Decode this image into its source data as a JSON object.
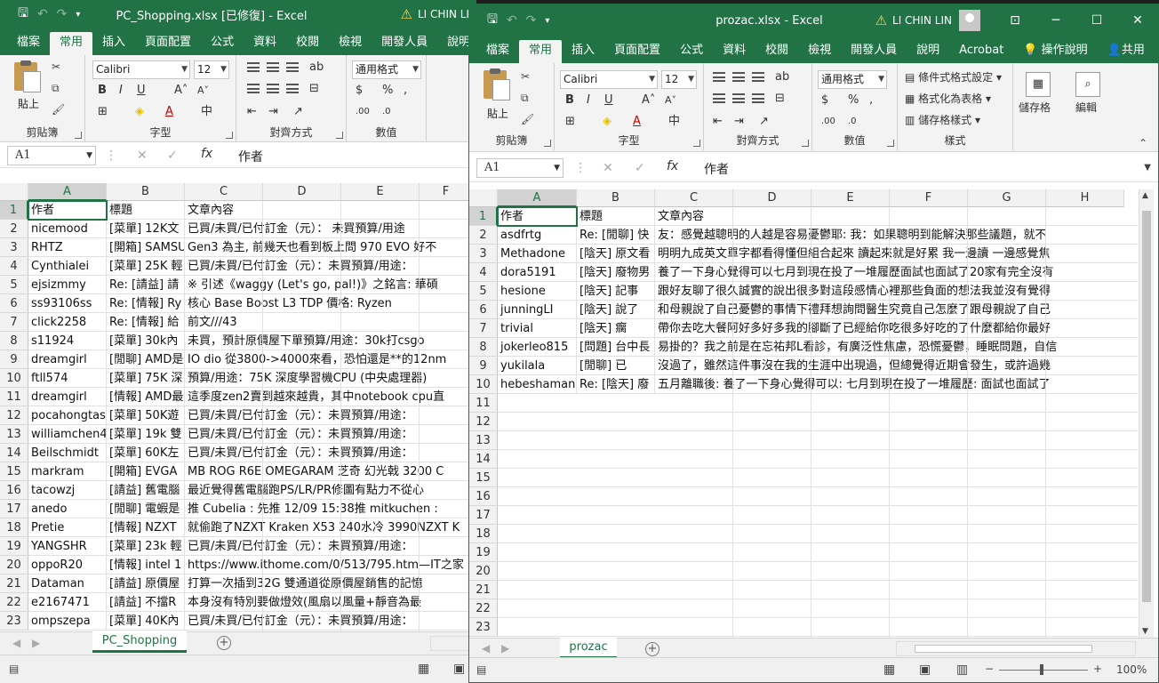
{
  "left_window": {
    "title": "PC_Shopping.xlsx [已修復] - Excel",
    "user": "LI CHIN LI",
    "tabs": [
      "檔案",
      "常用",
      "插入",
      "頁面配置",
      "公式",
      "資料",
      "校閱",
      "檢視",
      "開發人員",
      "說明"
    ],
    "ribbon": {
      "paste": "貼上",
      "clipboard": "剪貼簿",
      "font_group": "字型",
      "align_group": "對齊方式",
      "number_group": "數值",
      "font": "Calibri",
      "size": "12",
      "number_format": "通用格式"
    },
    "namebox": "A1",
    "formula": "作者",
    "columns": [
      "A",
      "B",
      "C",
      "D",
      "E",
      "F"
    ],
    "rows": [
      {
        "n": "1",
        "a": "作者",
        "b": "標題",
        "c": "文章內容"
      },
      {
        "n": "2",
        "a": "nicemood",
        "b": "[菜單] 12K文",
        "c": "已買/未買/已付訂金（元）： 未買預算/用途"
      },
      {
        "n": "3",
        "a": "RHTZ",
        "b": "[開箱] SAMSU",
        "c": "Gen3 為主, 前幾天也看到板上問 970 EVO 好不"
      },
      {
        "n": "4",
        "a": "Cynthialei",
        "b": "[菜單] 25K 輕",
        "c": "已買/未買/已付訂金（元）：未買預算/用途："
      },
      {
        "n": "5",
        "a": "ejsizmmy",
        "b": "Re: [請益] 請",
        "c": "※ 引述《waggy (Let's go, pal!)》之銘言: 華碩"
      },
      {
        "n": "6",
        "a": "ss93106ss",
        "b": "Re: [情報] Ry",
        "c": "核心   Base   Boost   L3     TDP     價格: Ryzen"
      },
      {
        "n": "7",
        "a": "click2258",
        "b": "Re: [情報] 給",
        "c": "前文///43"
      },
      {
        "n": "8",
        "a": "s11924",
        "b": "[菜單] 30k內",
        "c": "未買，預計原價屋下單預算/用途：30k打csgo"
      },
      {
        "n": "9",
        "a": "dreamgirl",
        "b": "[閒聊] AMD是",
        "c": "IO dio 從3800->4000來看，恐怕還是**的12nm"
      },
      {
        "n": "10",
        "a": "ftll574",
        "b": "[菜單] 75K 深",
        "c": "預算/用途：75K 深度學習機CPU (中央處理器)"
      },
      {
        "n": "11",
        "a": "dreamgirl",
        "b": "[情報] AMD最",
        "c": "這季度zen2賣到越來越貴，其中notebook cpu直"
      },
      {
        "n": "12",
        "a": "pocahongtas",
        "b": "[菜單] 50K遊",
        "c": "已買/未買/已付訂金（元）：未買預算/用途："
      },
      {
        "n": "13",
        "a": "williamchen4",
        "b": "[菜單] 19k 雙",
        "c": "已買/未買/已付訂金（元）：未買預算/用途："
      },
      {
        "n": "14",
        "a": "Beilschmidt",
        "b": "[菜單] 60K左",
        "c": "已買/未買/已付訂金（元）：未買預算/用途："
      },
      {
        "n": "15",
        "a": "markram",
        "b": "[開箱] EVGA",
        "c": "MB  ROG R6E OMEGARAM  芝奇 幻光戟 3200 C"
      },
      {
        "n": "16",
        "a": "tacowzj",
        "b": "[請益] 舊電腦",
        "c": "最近覺得舊電腦跑PS/LR/PR修圖有點力不從心"
      },
      {
        "n": "17",
        "a": "anedo",
        "b": "[閒聊] 電蝦是",
        "c": "推 Cubelia    : 先推 12/09 15:38推 mitkuchen  :"
      },
      {
        "n": "18",
        "a": "Pretie",
        "b": "[情報] NZXT",
        "c": "就偷跑了NZXT Kraken X53 240水冷 3990NZXT K"
      },
      {
        "n": "19",
        "a": "YANGSHR",
        "b": "[菜單] 23k 輕",
        "c": "已買/未買/已付訂金（元）：未買預算/用途："
      },
      {
        "n": "20",
        "a": "oppoR20",
        "b": "[情報] intel 1",
        "c": "https://www.ithome.com/0/513/795.htm—IT之家"
      },
      {
        "n": "21",
        "a": "Dataman",
        "b": "[請益] 原價屋",
        "c": "打算一次插到32G 雙通道從原價屋銷售的記憶"
      },
      {
        "n": "22",
        "a": "e2167471",
        "b": "[請益] 不擋R",
        "c": "本身沒有特別要做燈效(風扇以風量+靜音為最"
      },
      {
        "n": "23",
        "a": "ompszepa",
        "b": "[菜單] 40K內",
        "c": "已買/未買/已付訂金（元）：未買預算/用途："
      }
    ],
    "sheet_tab": "PC_Shopping"
  },
  "right_window": {
    "title": "prozac.xlsx - Excel",
    "user": "LI CHIN LIN",
    "tabs": [
      "檔案",
      "常用",
      "插入",
      "頁面配置",
      "公式",
      "資料",
      "校閱",
      "檢視",
      "開發人員",
      "說明",
      "Acrobat"
    ],
    "tell_me": "操作說明",
    "share": "共用",
    "ribbon": {
      "paste": "貼上",
      "clipboard": "剪貼簿",
      "font_group": "字型",
      "align_group": "對齊方式",
      "number_group": "數值",
      "styles_group": "樣式",
      "font": "Calibri",
      "size": "12",
      "number_format": "通用格式",
      "cond_format": "條件式格式設定",
      "format_table": "格式化為表格",
      "cell_styles": "儲存格樣式",
      "cells": "儲存格",
      "editing": "編輯"
    },
    "namebox": "A1",
    "formula": "作者",
    "columns": [
      "A",
      "B",
      "C",
      "D",
      "E",
      "F",
      "G",
      "H"
    ],
    "rows": [
      {
        "n": "1",
        "a": "作者",
        "b": "標題",
        "c": "文章內容"
      },
      {
        "n": "2",
        "a": "asdfrtg",
        "b": "Re: [閒聊] 快",
        "c": "友：感覺越聰明的人越是容易憂鬱耶: 我：如果聰明到能解決那些議題，就不"
      },
      {
        "n": "3",
        "a": "Methadone",
        "b": "[陰天] 原文看",
        "c": "明明九成英文單字都看得懂但組合起來 讀起來就是好累 我一邊讀 一邊感覺焦"
      },
      {
        "n": "4",
        "a": "dora5191",
        "b": "[陰天] 廢物男",
        "c": "養了一下身心覺得可以七月到現在投了一堆履歷面試也面試了20家有完全沒有"
      },
      {
        "n": "5",
        "a": "hesione",
        "b": "[陰天] 記事",
        "c": "跟好友聊了很久誠實的說出很多對這段感情心裡那些負面的想法我並沒有覺得"
      },
      {
        "n": "6",
        "a": "junningLI",
        "b": "[陰天] 說了",
        "c": "和母親說了自己憂鬱的事情下禮拜想詢問醫生究竟自己怎麼了跟母親說了自己"
      },
      {
        "n": "7",
        "a": "trivial",
        "b": "[陰天] 瘸",
        "c": "帶你去吃大餐阿好多好多我的腳斷了已經給你吃很多好吃的了什麼都給你最好"
      },
      {
        "n": "8",
        "a": "jokerleo815",
        "b": "[問題] 台中長",
        "c": "易掛的？我之前是在忘祐邦L看診，有廣泛性焦慮，恐慌憂鬱，睡眠問題，自信"
      },
      {
        "n": "9",
        "a": "yukilala",
        "b": "[閒聊] 已",
        "c": "沒過了，雖然這件事沒在我的生涯中出現過，但總覺得近期會發生，或許過幾"
      },
      {
        "n": "10",
        "a": "hebeshaman",
        "b": "Re: [陰天] 廢",
        "c": "五月離職後: 養了一下身心覺得可以: 七月到現在投了一堆履歷: 面試也面試了"
      },
      {
        "n": "11"
      },
      {
        "n": "12"
      },
      {
        "n": "13"
      },
      {
        "n": "14"
      },
      {
        "n": "15"
      },
      {
        "n": "16"
      },
      {
        "n": "17"
      },
      {
        "n": "18"
      },
      {
        "n": "19"
      },
      {
        "n": "20"
      },
      {
        "n": "21"
      },
      {
        "n": "22"
      },
      {
        "n": "23"
      }
    ],
    "sheet_tab": "prozac",
    "zoom": "100%"
  },
  "colors": {
    "excel_green": "#217346",
    "ribbon_bg": "#f3f3f3",
    "header_bg": "#f2f2f2"
  }
}
